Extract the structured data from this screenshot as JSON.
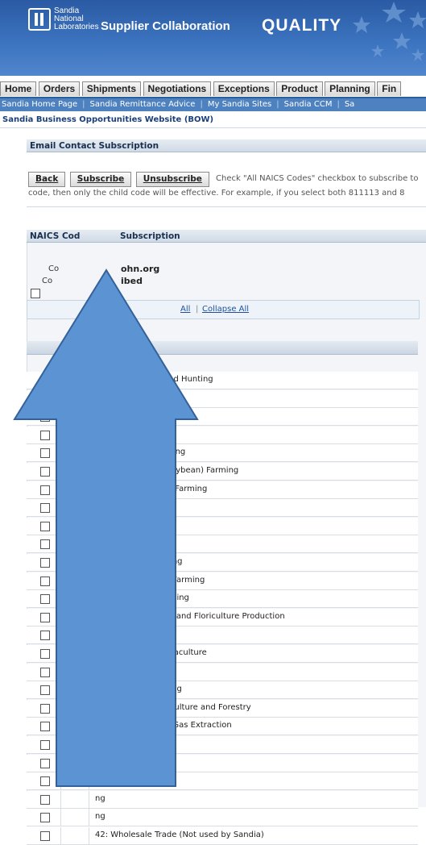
{
  "header": {
    "logo_lines": [
      "Sandia",
      "National",
      "Laboratories"
    ],
    "app_title": "Supplier Collaboration",
    "app_section": "QUALITY"
  },
  "tabs": [
    "Home",
    "Orders",
    "Shipments",
    "Negotiations",
    "Exceptions",
    "Product",
    "Planning",
    "Fin"
  ],
  "quick_links": [
    "Sandia Home Page",
    "Sandia Remittance Advice",
    "My Sandia Sites",
    "Sandia CCM",
    "Sa"
  ],
  "bow_link": "Sandia Business Opportunities Website (BOW)",
  "email_section": {
    "title": "Email Contact Subscription",
    "buttons": {
      "back": "Back",
      "subscribe": "Subscribe",
      "unsubscribe": "Unsubscribe"
    },
    "hint_line1": "Check \"All NAICS Codes\" checkbox to subscribe to",
    "hint_line2": "code, then only the child code will be effective. For example, if you select both 811113 and 8"
  },
  "naics_section": {
    "title_left": "NAICS Cod",
    "title_right": "Subscription",
    "info": [
      {
        "label": "Co",
        "value": "ohn.org"
      },
      {
        "label": "Co",
        "value": "ibed"
      }
    ],
    "expand_all": "All",
    "collapse_all": "Collapse All"
  },
  "naics_rows": [
    " Forestry, Fishing and Hunting",
    "oduction",
    "eed and Grain Farming",
    ": Soybean Farming",
    "110: Soybean Farming",
    ": Oilseed (except Soybean) Farming",
    ": Dry Pea and Bean Farming",
    ": Wheat Farming",
    ": Corn Farming",
    ": Rice Farming",
    ": Other Grain Farming",
    "getable and Melon Farming",
    "it and Tree Nut Farming",
    "eenhouse, Nursery, and Floriculture Production",
    "her Crop Farming",
    " Production and Aquaculture",
    "y and Logging",
    " Hunting and Trapping",
    "t Activities for Agriculture and Forestry",
    "rrying, and Oil and Gas Extraction",
    "",
    "n",
    "ng",
    "ng",
    "ng",
    "42: Wholesale Trade (Not used by Sandia)"
  ],
  "colors": {
    "banner": "#3c73bf",
    "link_bar": "#4e81bf",
    "arrow_fill": "#5b93d3",
    "arrow_stroke": "#35619a"
  }
}
